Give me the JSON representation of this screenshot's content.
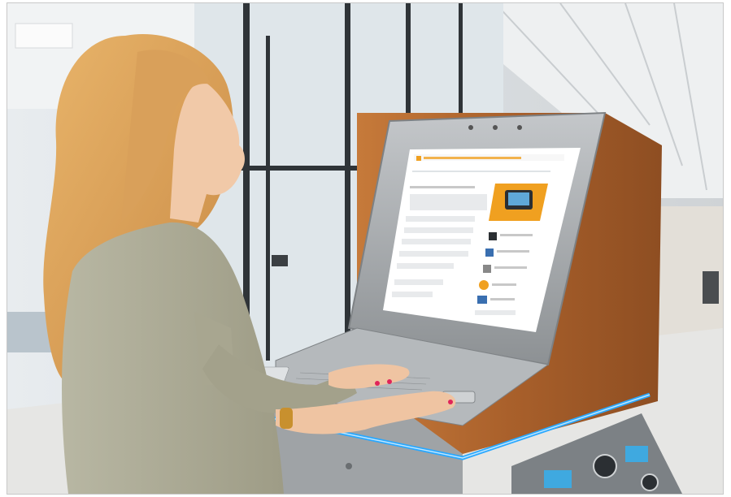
{
  "photo": {
    "subject": "",
    "screen_header": ""
  },
  "colors": {
    "accent_orange": "#f0a020",
    "led_blue": "#2aa8ff",
    "wood": "#b5672f",
    "steel": "#a9adb0"
  }
}
